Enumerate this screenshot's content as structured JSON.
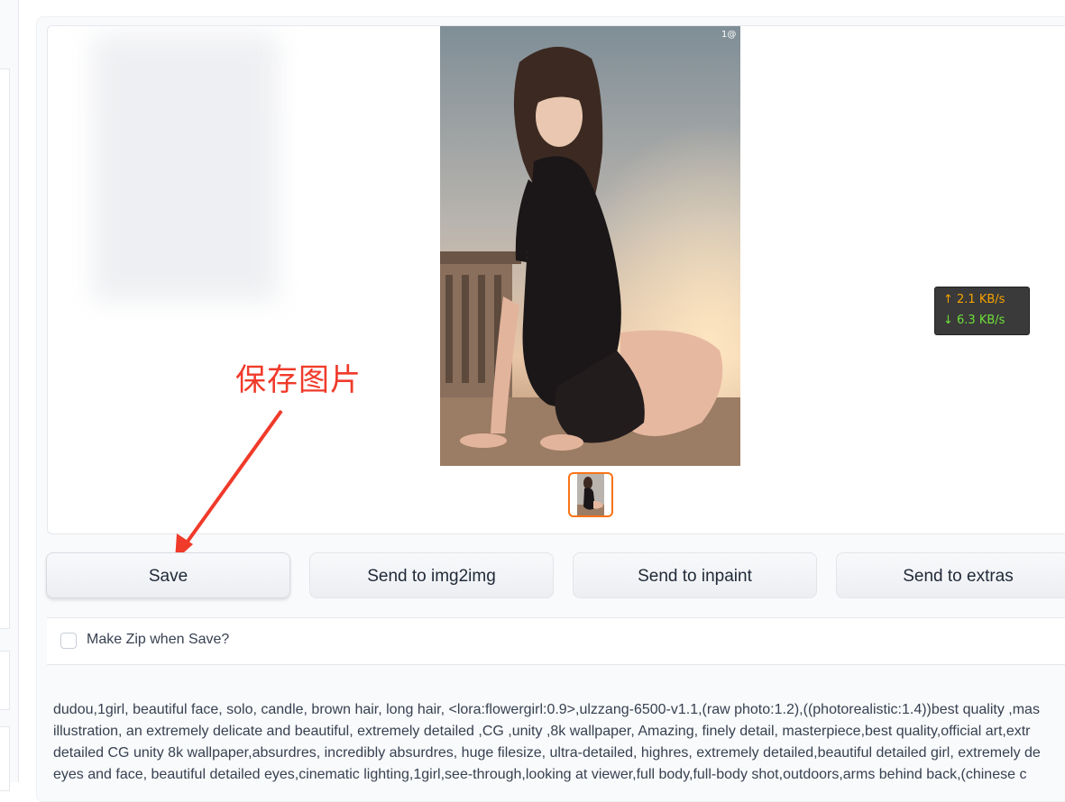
{
  "annotation": {
    "text": "保存图片",
    "color": "#f03a2a"
  },
  "network": {
    "up": "↑ 2.1 KB/s",
    "down": "↓ 6.3 KB/s"
  },
  "gallery": {
    "watermark": "1@"
  },
  "buttons": {
    "save": "Save",
    "img2img": "Send to img2img",
    "inpaint": "Send to inpaint",
    "extras": "Send to extras"
  },
  "zip": {
    "label": "Make Zip when Save?",
    "checked": false
  },
  "prompt_lines": [
    "dudou,1girl, beautiful face, solo, candle, brown hair, long hair, <lora:flowergirl:0.9>,ulzzang-6500-v1.1,(raw photo:1.2),((photorealistic:1.4))best quality ,mas",
    "illustration, an extremely delicate and beautiful, extremely detailed ,CG ,unity ,8k wallpaper, Amazing, finely detail, masterpiece,best quality,official art,extr",
    "detailed CG unity 8k wallpaper,absurdres, incredibly absurdres, huge filesize, ultra-detailed, highres, extremely detailed,beautiful detailed girl, extremely de",
    "eyes and face, beautiful detailed eyes,cinematic lighting,1girl,see-through,looking at viewer,full body,full-body shot,outdoors,arms behind back,(chinese c"
  ],
  "colors": {
    "accent": "#f97316",
    "up": "#f7a300",
    "down": "#6ee03a"
  }
}
